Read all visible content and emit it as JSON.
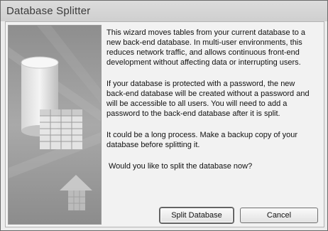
{
  "window": {
    "title": "Database Splitter"
  },
  "message": {
    "paragraphs": [
      "This wizard moves tables from your current database to a\nnew back-end database. In multi-user environments, this\nreduces network traffic, and allows continuous front-end\ndevelopment without affecting data or interrupting users.",
      "If your database is protected with a password, the new\nback-end database will be created without a password and\nwill be accessible to all users.  You will need to add a\npassword to the back-end database after it is split.",
      "It could be a long process. Make a backup copy of your\ndatabase before splitting it.",
      "Would you like to split the database now?"
    ]
  },
  "buttons": {
    "split_label": "Split Database",
    "cancel_label": "Cancel"
  },
  "illustration": {
    "icons": [
      "database-cylinder-icon",
      "table-grid-icon",
      "upload-arrow-icon"
    ]
  }
}
